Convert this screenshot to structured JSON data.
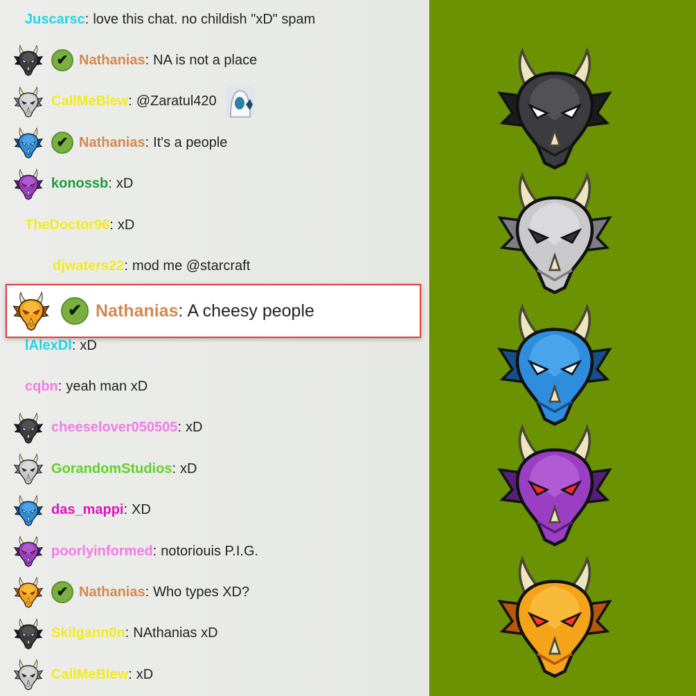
{
  "chat": {
    "messages": [
      {
        "user": "Juscarsc",
        "color": "#1fd6e5",
        "text": "love this chat. no childish \"xD\" spam",
        "avatar": null,
        "badge": false,
        "indent": 0
      },
      {
        "user": "Nathanias",
        "color": "#d3884f",
        "text": "NA is not a place",
        "avatar": "black-dragon",
        "badge": true,
        "indent": 1
      },
      {
        "user": "CallMeBlew",
        "color": "#f2ea20",
        "text": "@Zaratul420",
        "avatar": "silver-dragon",
        "badge": false,
        "indent": 1,
        "emote": "hooded-figure-emote"
      },
      {
        "user": "Nathanias",
        "color": "#d3884f",
        "text": "It's a people",
        "avatar": "blue-dragon",
        "badge": true,
        "indent": 1
      },
      {
        "user": "konossb",
        "color": "#1e9a3c",
        "text": "xD",
        "avatar": "purple-dragon",
        "badge": false,
        "indent": 1
      },
      {
        "user": "TheDoctor96",
        "color": "#f2ea20",
        "text": "xD",
        "avatar": null,
        "badge": false,
        "indent": 0
      },
      {
        "user": "djwaters22",
        "color": "#f2ea20",
        "text": "mod me @starcraft",
        "avatar": null,
        "badge": false,
        "indent": 2
      },
      {
        "user": "lAlexDl",
        "color": "#1fd6e5",
        "text": "xD",
        "avatar": null,
        "badge": false,
        "indent": 0
      },
      {
        "user": "cqbn",
        "color": "#f27be8",
        "text": "yeah man xD",
        "avatar": null,
        "badge": false,
        "indent": 0
      },
      {
        "user": "cheeselover050505",
        "color": "#f27be8",
        "text": "xD",
        "avatar": "black-dragon",
        "badge": false,
        "indent": 1
      },
      {
        "user": "GorandomStudios",
        "color": "#5fd12a",
        "text": "xD",
        "avatar": "silver-dragon",
        "badge": false,
        "indent": 1
      },
      {
        "user": "das_mappi",
        "color": "#e20fc3",
        "text": "XD",
        "avatar": "blue-dragon",
        "badge": false,
        "indent": 1
      },
      {
        "user": "poorlyinformed",
        "color": "#f27be8",
        "text": "notoriouis P.I.G.",
        "avatar": "purple-dragon",
        "badge": false,
        "indent": 1
      },
      {
        "user": "Nathanias",
        "color": "#d3884f",
        "text": "Who types XD?",
        "avatar": "gold-dragon",
        "badge": true,
        "indent": 1
      },
      {
        "user": "Skilgann0n",
        "color": "#f2ea20",
        "text": "NAthanias xD",
        "avatar": "black-dragon",
        "badge": false,
        "indent": 1
      },
      {
        "user": "CallMeBlew",
        "color": "#f2ea20",
        "text": "xD",
        "avatar": "silver-dragon",
        "badge": false,
        "indent": 1
      }
    ],
    "highlight": {
      "user": "Nathanias",
      "color": "#d3884f",
      "text": "A cheesy people",
      "avatar": "gold-dragon",
      "badge": true
    }
  },
  "badge_symbol": "✔",
  "separator": ":",
  "dragons": {
    "black-dragon": {
      "main": "#3c3c40",
      "dark": "#1c1c1f",
      "light": "#6b6b70",
      "eye": "#ffffff"
    },
    "silver-dragon": {
      "main": "#c9c9cc",
      "dark": "#7d7d82",
      "light": "#f0f0f2",
      "eye": "#333333"
    },
    "blue-dragon": {
      "main": "#2f8ddd",
      "dark": "#16508a",
      "light": "#6cc0ff",
      "eye": "#e8f6ff"
    },
    "purple-dragon": {
      "main": "#9a3fc4",
      "dark": "#56207a",
      "light": "#cc7ee8",
      "eye": "#ff2a2a"
    },
    "gold-dragon": {
      "main": "#f5a41a",
      "dark": "#b8560a",
      "light": "#ffd560",
      "eye": "#ff3a1a"
    }
  },
  "sidebar_dragons": [
    "black-dragon",
    "silver-dragon",
    "blue-dragon",
    "purple-dragon",
    "gold-dragon"
  ],
  "colors": {
    "sidebar_bg": "#6b9202",
    "highlight_border": "#e23b3b",
    "badge_bg": "#79b041"
  }
}
